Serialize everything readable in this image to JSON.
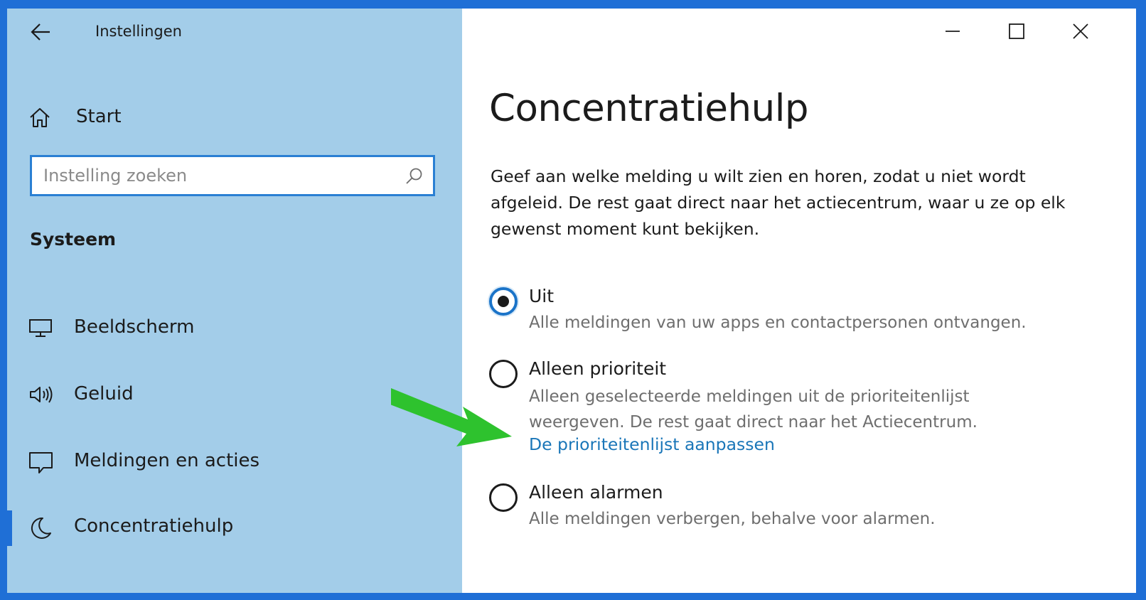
{
  "app": {
    "title": "Instellingen"
  },
  "sidebar": {
    "home_label": "Start",
    "search": {
      "placeholder": "Instelling zoeken",
      "value": ""
    },
    "section_title": "Systeem",
    "items": [
      {
        "label": "Beeldscherm",
        "icon": "monitor-icon"
      },
      {
        "label": "Geluid",
        "icon": "speaker-icon"
      },
      {
        "label": "Meldingen en acties",
        "icon": "notification-icon"
      },
      {
        "label": "Concentratiehulp",
        "icon": "moon-icon",
        "selected": true
      }
    ]
  },
  "window_controls": {
    "minimize": "minimize-icon",
    "maximize": "maximize-icon",
    "close": "close-icon"
  },
  "main": {
    "title": "Concentratiehulp",
    "intro": "Geef aan welke melding u wilt zien en horen, zodat u niet wordt afgeleid. De rest gaat direct naar het actiecentrum, waar u ze op elk gewenst moment kunt bekijken.",
    "options": [
      {
        "label": "Uit",
        "description": "Alle meldingen van uw apps en contactpersonen ontvangen.",
        "selected": true
      },
      {
        "label": "Alleen prioriteit",
        "description": "Alleen geselecteerde meldingen uit de prioriteitenlijst weergeven. De rest gaat direct naar het Actiecentrum.",
        "link": "De prioriteitenlijst aanpassen",
        "selected": false
      },
      {
        "label": "Alleen alarmen",
        "description": "Alle meldingen verbergen, behalve voor alarmen.",
        "selected": false
      }
    ]
  },
  "colors": {
    "sidebar_bg": "#a3cde9",
    "accent": "#1a73c8",
    "link": "#1a76b8",
    "annotation_arrow": "#2ec22e",
    "frame": "#1f6fd6"
  }
}
